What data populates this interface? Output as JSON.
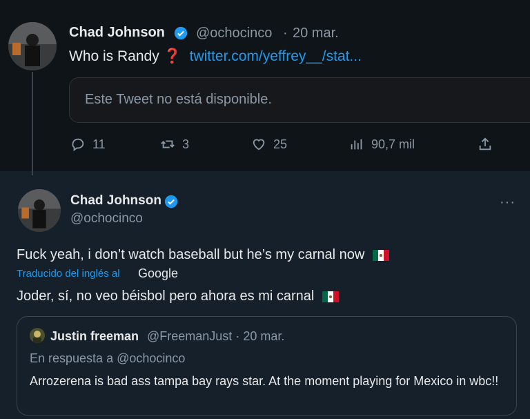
{
  "tweet1": {
    "author_name": "Chad Johnson",
    "handle": "@ochocinco",
    "date_sep": "·",
    "date": "20 mar.",
    "text": "Who is Randy",
    "question_glyph": "❓",
    "link": "twitter.com/yeffrey__/stat...",
    "unavailable": "Este Tweet no está disponible.",
    "actions": {
      "replies": "11",
      "retweets": "3",
      "likes": "25",
      "views": "90,7 mil"
    }
  },
  "tweet2": {
    "author_name": "Chad Johnson",
    "handle": "@ochocinco",
    "more": "···",
    "text": "Fuck yeah, i don’t watch baseball but he’s my carnal now",
    "translated_label": "Traducido del inglés al",
    "translator": "Google",
    "translated_text": "Joder, sí, no veo béisbol pero ahora es mi carnal",
    "flag_icon": "mexico-flag-icon"
  },
  "quote": {
    "author_name": "Justin freeman",
    "handle": "@FreemanJust",
    "date_sep": "·",
    "date": "20 mar.",
    "reply_to": "En respuesta a @ochocinco",
    "text": "Arrozerena is bad ass tampa bay rays star. At the moment playing for Mexico in wbc!!"
  },
  "colors": {
    "background": "#15202b",
    "top_background": "#0f1419",
    "text": "#e7e9ea",
    "secondary": "#8b98a5",
    "link": "#1d9bf0"
  }
}
